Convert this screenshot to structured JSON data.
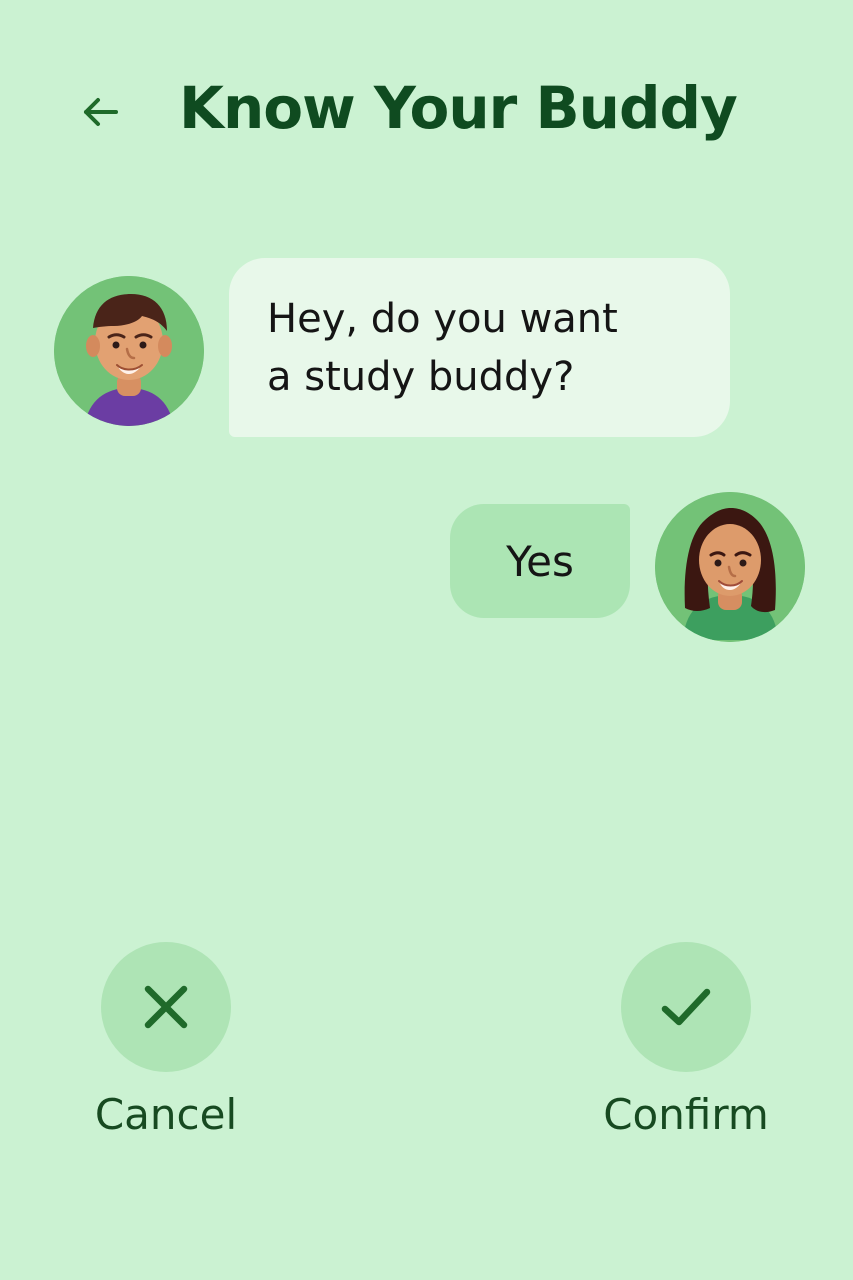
{
  "header": {
    "title": "Know Your Buddy",
    "back_icon": "arrow-left-icon"
  },
  "messages": [
    {
      "sender": "buddy",
      "text": "Hey, do you want\na study buddy?"
    },
    {
      "sender": "user",
      "text": "Yes"
    }
  ],
  "actions": {
    "cancel_label": "Cancel",
    "confirm_label": "Confirm",
    "cancel_icon": "close-icon",
    "confirm_icon": "check-icon"
  },
  "colors": {
    "background": "#cbf2d2",
    "title": "#0f4b20",
    "incoming_bubble": "#e8f8ea",
    "outgoing_bubble": "#ace5b4",
    "action_circle": "#aee4b5",
    "accent": "#1f6a2a"
  }
}
